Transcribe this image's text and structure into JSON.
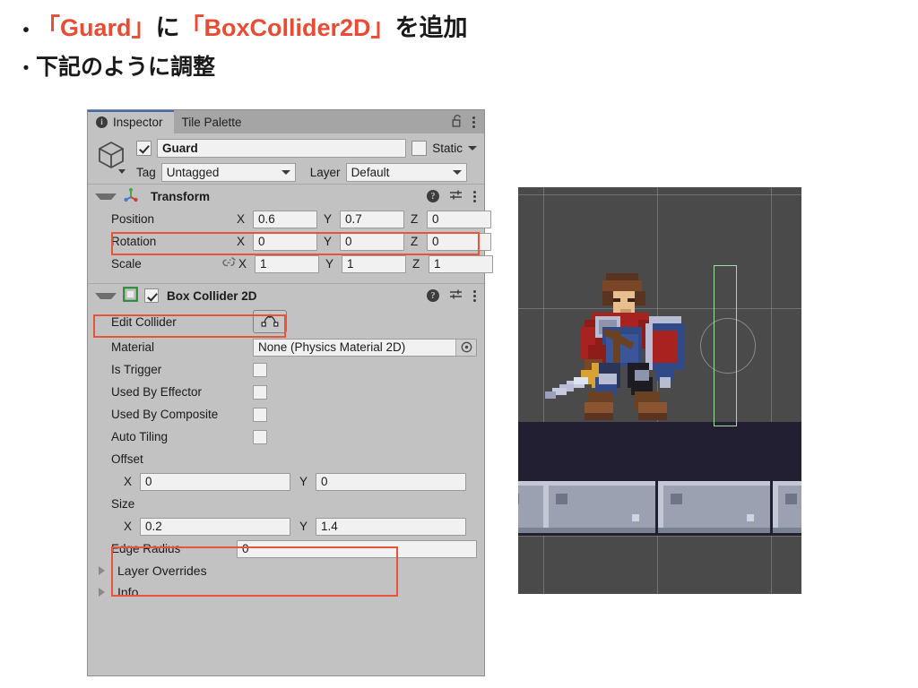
{
  "slide": {
    "bullets": [
      {
        "dot": "•",
        "parts": [
          {
            "text": "「Guard」",
            "accent": true
          },
          {
            "text": "に",
            "accent": false
          },
          {
            "text": "「BoxCollider2D」",
            "accent": true
          },
          {
            "text": "を追加",
            "accent": false
          }
        ]
      },
      {
        "dot": "・",
        "parts": [
          {
            "text": "下記のように調整",
            "accent": false
          }
        ]
      }
    ]
  },
  "inspector": {
    "tabs": [
      {
        "label": "Inspector",
        "icon": "info-icon",
        "active": true
      },
      {
        "label": "Tile Palette",
        "icon": "",
        "active": false
      }
    ],
    "header_icons": {
      "lock": "lock-open-icon",
      "menu": "kebab-menu-icon"
    },
    "gameobject": {
      "icon": "cube-icon",
      "enabled": true,
      "name": "Guard",
      "static_label": "Static",
      "static_checked": false,
      "tag_label": "Tag",
      "tag_value": "Untagged",
      "layer_label": "Layer",
      "layer_value": "Default"
    },
    "transform": {
      "title": "Transform",
      "icon": "transform-axis-icon",
      "expanded": true,
      "rows": [
        {
          "name": "Position",
          "x": "0.6",
          "y": "0.7",
          "z": "0",
          "highlight": true,
          "link": false
        },
        {
          "name": "Rotation",
          "x": "0",
          "y": "0",
          "z": "0",
          "highlight": false,
          "link": false
        },
        {
          "name": "Scale",
          "x": "1",
          "y": "1",
          "z": "1",
          "highlight": false,
          "link": true
        }
      ],
      "axis_labels": {
        "x": "X",
        "y": "Y",
        "z": "Z"
      }
    },
    "box_collider_2d": {
      "title": "Box Collider 2D",
      "icon": "box-collider-2d-icon",
      "enabled": true,
      "expanded": true,
      "highlight": true,
      "edit_collider_label": "Edit Collider",
      "edit_collider_icon": "edit-collider-icon",
      "material_label": "Material",
      "material_value": "None (Physics Material 2D)",
      "material_picker_icon": "object-picker-icon",
      "toggles": [
        {
          "label": "Is Trigger",
          "checked": false
        },
        {
          "label": "Used By Effector",
          "checked": false
        },
        {
          "label": "Used By Composite",
          "checked": false
        },
        {
          "label": "Auto Tiling",
          "checked": false
        }
      ],
      "offset": {
        "label": "Offset",
        "x_label": "X",
        "x": "0",
        "y_label": "Y",
        "y": "0"
      },
      "size": {
        "label": "Size",
        "x_label": "X",
        "x": "0.2",
        "y_label": "Y",
        "y": "1.4",
        "highlight": true
      },
      "edge_radius": {
        "label": "Edge Radius",
        "value": "0"
      }
    },
    "folds": [
      {
        "label": "Layer Overrides"
      },
      {
        "label": "Info"
      }
    ]
  },
  "scene": {
    "name": "scene-preview",
    "collider_outline_color": "#9fe09f",
    "background_color": "#4a4a4a",
    "ground_band_color": "#221f33",
    "brick_color": "#9ba1b0"
  },
  "colors": {
    "accent_red": "#ea4b33",
    "highlight_red": "#e8533a",
    "panel_bg": "#c2c2c2",
    "tab_bg": "#a5a5a5",
    "field_bg": "#f1f1f1",
    "tab_accent": "#3c6cb4"
  }
}
